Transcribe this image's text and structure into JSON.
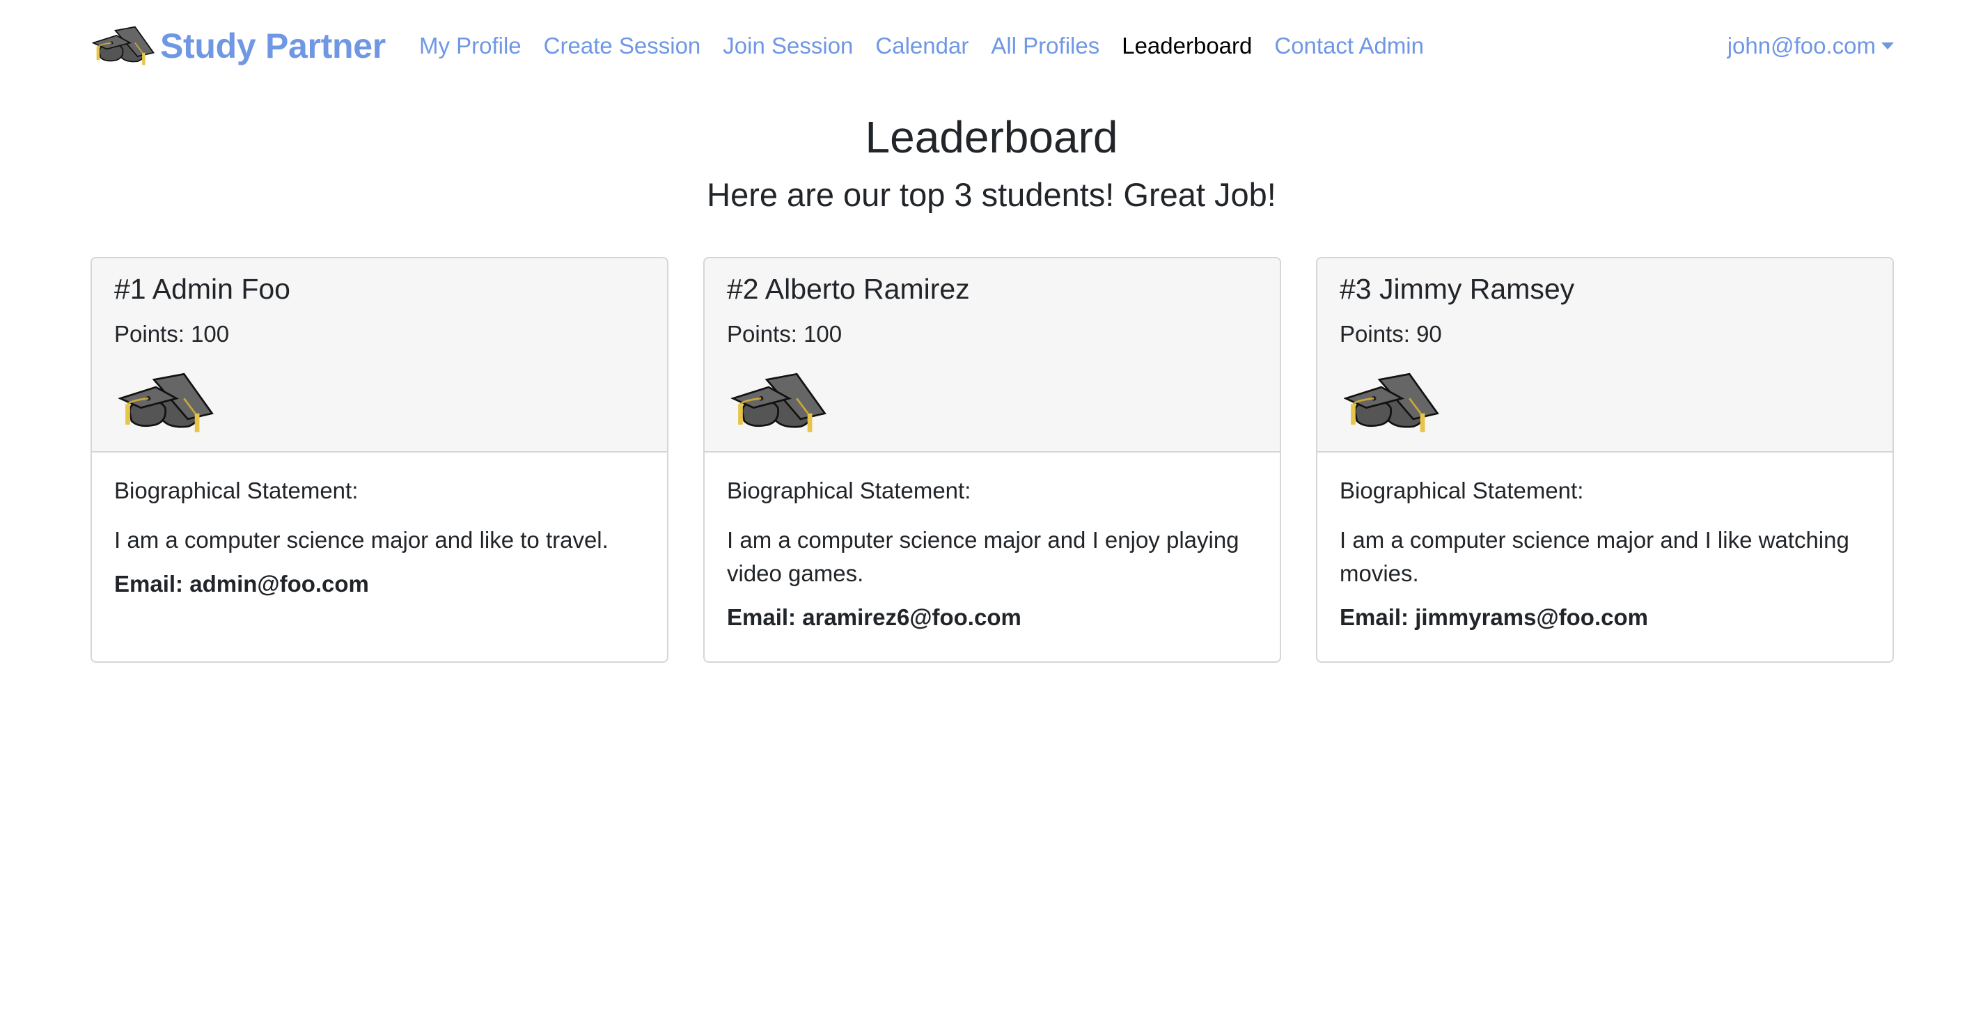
{
  "navbar": {
    "brand": "Study Partner",
    "links": [
      {
        "label": "My Profile"
      },
      {
        "label": "Create Session"
      },
      {
        "label": "Join Session"
      },
      {
        "label": "Calendar"
      },
      {
        "label": "All Profiles"
      },
      {
        "label": "Leaderboard",
        "active": true
      },
      {
        "label": "Contact Admin"
      }
    ],
    "user": "john@foo.com"
  },
  "page": {
    "title": "Leaderboard",
    "subtitle": "Here are our top 3 students! Great Job!"
  },
  "labels": {
    "points": "Points:",
    "bio": "Biographical Statement:",
    "email": "Email:"
  },
  "leaders": [
    {
      "title": "#1 Admin Foo",
      "points": "100",
      "bio": "I am a computer science major and like to travel.",
      "email": "admin@foo.com"
    },
    {
      "title": "#2 Alberto Ramirez",
      "points": "100",
      "bio": "I am a computer science major and I enjoy playing video games.",
      "email": "aramirez6@foo.com"
    },
    {
      "title": "#3 Jimmy Ramsey",
      "points": "90",
      "bio": "I am a computer science major and I like watching movies.",
      "email": "jimmyrams@foo.com"
    }
  ],
  "colors": {
    "accent": "#6f97e4",
    "card_header_bg": "#f6f6f6",
    "border": "#d6d6d6"
  },
  "icons": {
    "brand": "graduation-caps-icon",
    "avatar": "graduation-caps-icon"
  }
}
